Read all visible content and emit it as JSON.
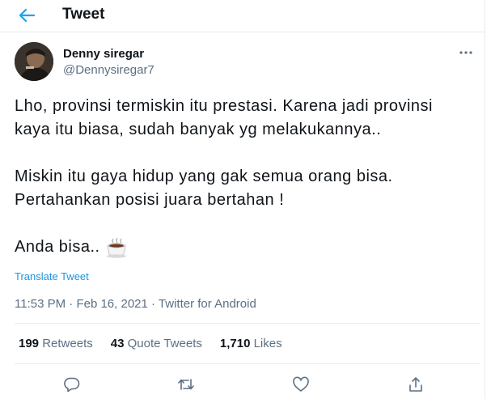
{
  "header": {
    "title": "Tweet",
    "back_icon": "arrow-left-icon"
  },
  "author": {
    "name": "Denny siregar",
    "handle": "@Dennysiregar7"
  },
  "tweet": {
    "lines_para1": [
      "Lho, provinsi termiskin itu prestasi. Karena jadi provinsi",
      "kaya itu biasa, sudah banyak yg melakukannya.."
    ],
    "lines_para2": [
      "Miskin itu gaya hidup yang gak semua orang bisa.",
      "Pertahankan posisi juara bertahan !"
    ],
    "signoff": "Anda bisa..",
    "emoji": "hot-beverage-emoji"
  },
  "translate_label": "Translate Tweet",
  "meta": {
    "time": "11:53 PM",
    "sep": " · ",
    "date": "Feb 16, 2021",
    "client": "Twitter for Android"
  },
  "stats": {
    "retweets_count": "199",
    "retweets_label": "Retweets",
    "quotes_count": "43",
    "quotes_label": "Quote Tweets",
    "likes_count": "1,710",
    "likes_label": "Likes"
  },
  "colors": {
    "accent": "#1da1f2",
    "link": "#1b95e0",
    "muted": "#5b7083",
    "divider": "#e6ecf0"
  }
}
